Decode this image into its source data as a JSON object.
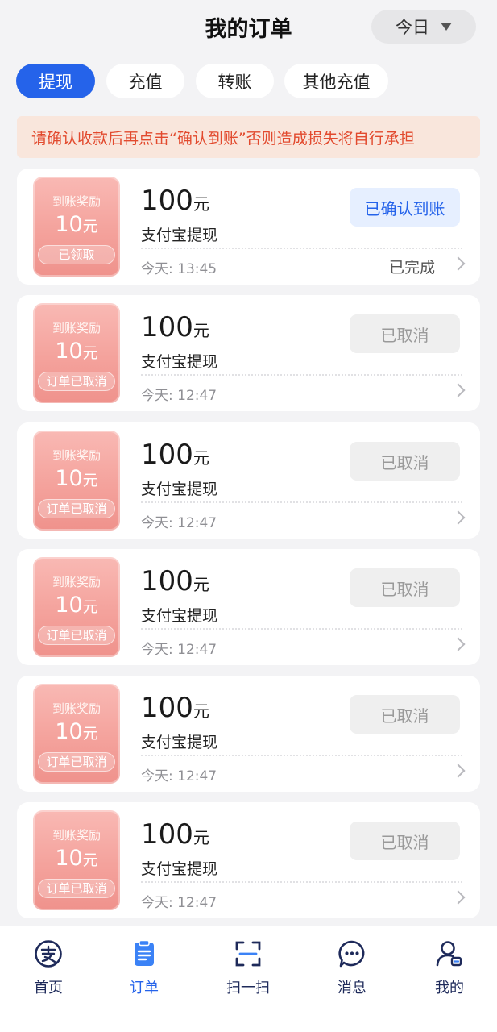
{
  "header": {
    "title": "我的订单",
    "date_filter": "今日"
  },
  "tabs": [
    {
      "label": "提现",
      "active": true
    },
    {
      "label": "充值",
      "active": false
    },
    {
      "label": "转账",
      "active": false
    },
    {
      "label": "其他充值",
      "active": false
    }
  ],
  "warning": "请确认收款后再点击“确认到账”否则造成损失将自行承担",
  "orders": [
    {
      "reward_title": "到账奖励",
      "reward_amount": "10",
      "reward_unit": "元",
      "reward_status": "已领取",
      "amount": "100",
      "unit": "元",
      "method": "支付宝提现",
      "time": "今天: 13:45",
      "action": "已确认到账",
      "status": "已完成"
    },
    {
      "reward_title": "到账奖励",
      "reward_amount": "10",
      "reward_unit": "元",
      "reward_status": "订单已取消",
      "amount": "100",
      "unit": "元",
      "method": "支付宝提现",
      "time": "今天: 12:47",
      "action": "已取消",
      "status": ""
    },
    {
      "reward_title": "到账奖励",
      "reward_amount": "10",
      "reward_unit": "元",
      "reward_status": "订单已取消",
      "amount": "100",
      "unit": "元",
      "method": "支付宝提现",
      "time": "今天: 12:47",
      "action": "已取消",
      "status": ""
    },
    {
      "reward_title": "到账奖励",
      "reward_amount": "10",
      "reward_unit": "元",
      "reward_status": "订单已取消",
      "amount": "100",
      "unit": "元",
      "method": "支付宝提现",
      "time": "今天: 12:47",
      "action": "已取消",
      "status": ""
    },
    {
      "reward_title": "到账奖励",
      "reward_amount": "10",
      "reward_unit": "元",
      "reward_status": "订单已取消",
      "amount": "100",
      "unit": "元",
      "method": "支付宝提现",
      "time": "今天: 12:47",
      "action": "已取消",
      "status": ""
    },
    {
      "reward_title": "到账奖励",
      "reward_amount": "10",
      "reward_unit": "元",
      "reward_status": "订单已取消",
      "amount": "100",
      "unit": "元",
      "method": "支付宝提现",
      "time": "今天: 12:47",
      "action": "已取消",
      "status": ""
    }
  ],
  "nav": [
    {
      "label": "首页",
      "icon": "alipay-icon",
      "active": false
    },
    {
      "label": "订单",
      "icon": "order-icon",
      "active": true
    },
    {
      "label": "扫一扫",
      "icon": "scan-icon",
      "active": false
    },
    {
      "label": "消息",
      "icon": "message-icon",
      "active": false
    },
    {
      "label": "我的",
      "icon": "profile-icon",
      "active": false
    }
  ],
  "colors": {
    "accent": "#2563ea",
    "warning_text": "#e24a2e",
    "warning_bg": "#f9e6dc",
    "reward_bg": "#f4a29c"
  }
}
